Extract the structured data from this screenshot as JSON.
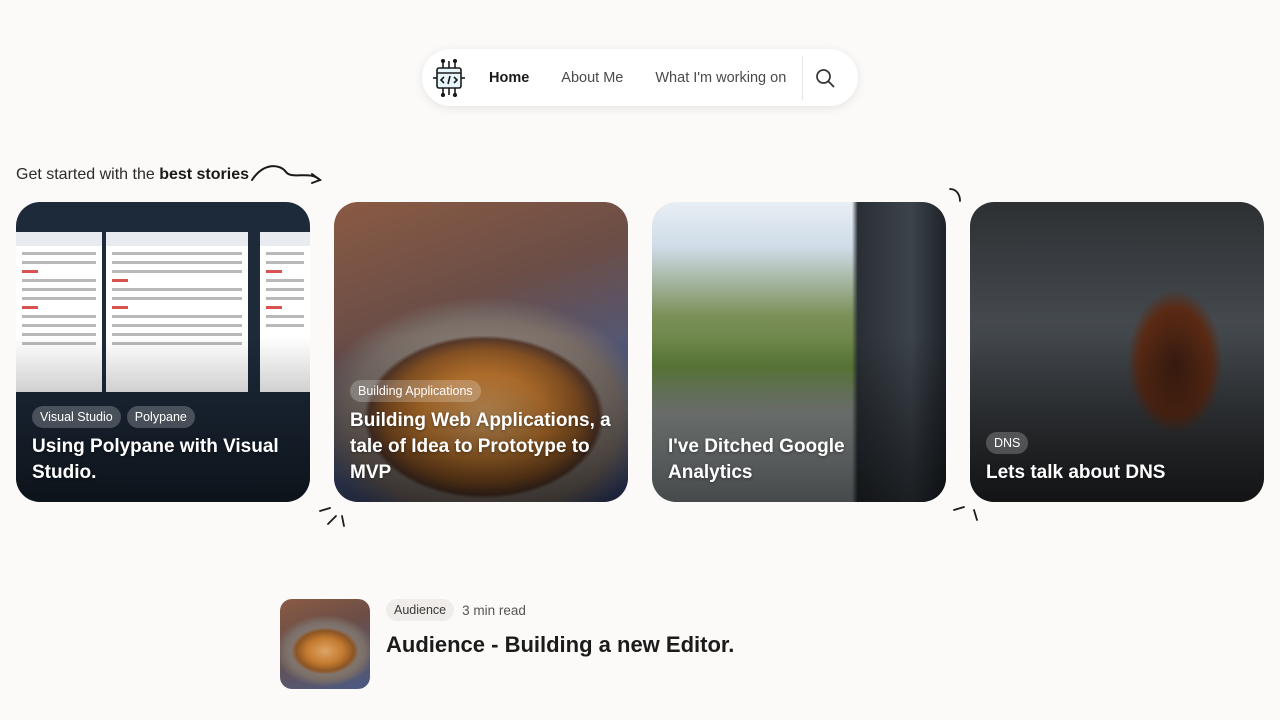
{
  "nav": {
    "logo_icon": "code-window-icon",
    "links": [
      {
        "label": "Home",
        "active": true
      },
      {
        "label": "About Me",
        "active": false
      },
      {
        "label": "What I'm working on",
        "active": false
      }
    ],
    "search_icon": "search-icon"
  },
  "section": {
    "heading_prefix": "Get started with the ",
    "heading_bold": "best stories"
  },
  "stories": [
    {
      "tags": [
        "Visual Studio",
        "Polypane"
      ],
      "title": "Using Polypane with Visual Studio."
    },
    {
      "tags": [
        "Building Applications"
      ],
      "title": "Building Web Applications, a tale of Idea to Prototype to MVP"
    },
    {
      "tags": [],
      "title": "I've Ditched Google Analytics"
    },
    {
      "tags": [
        "DNS"
      ],
      "title": "Lets talk about DNS"
    }
  ],
  "featured": {
    "tag": "Audience",
    "read_time": "3 min read",
    "title": "Audience - Building a new Editor."
  },
  "colors": {
    "background": "#fcfaf8",
    "accent_text": "#1b1b1b"
  }
}
